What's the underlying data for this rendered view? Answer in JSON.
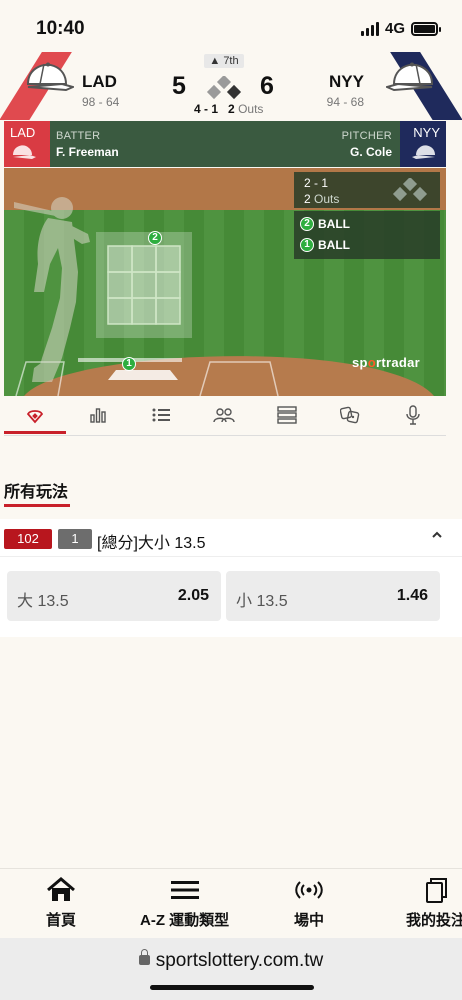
{
  "status_bar": {
    "time": "10:40",
    "network": "4G"
  },
  "scoreboard": {
    "home": {
      "abbr": "LAD",
      "record": "98 - 64",
      "score": "5",
      "color": "#e04a4f"
    },
    "away": {
      "abbr": "NYY",
      "record": "94 - 68",
      "score": "6",
      "color": "#1f2a5c"
    },
    "inning": "▲ 7th",
    "count": "4 - 1",
    "outs": "2",
    "outs_label": "Outs"
  },
  "matchup": {
    "batter_team": "LAD",
    "batter_label": "BATTER",
    "batter_name": "F. Freeman",
    "pitcher_team": "NYY",
    "pitcher_label": "PITCHER",
    "pitcher_name": "G. Cole"
  },
  "field": {
    "count": "2 - 1",
    "outs": "2",
    "outs_label": "Outs",
    "pitches": [
      {
        "number": "2",
        "result": "BALL"
      },
      {
        "number": "1",
        "result": "BALL"
      }
    ],
    "watermark": {
      "pre": "sp",
      "mid": "o",
      "post": "rtradar"
    }
  },
  "tabs": [
    {
      "icon": "baseball-field-icon",
      "active": true
    },
    {
      "icon": "stats-bars-icon",
      "active": false
    },
    {
      "icon": "play-by-play-list-icon",
      "active": false
    },
    {
      "icon": "lineup-players-icon",
      "active": false
    },
    {
      "icon": "standings-table-icon",
      "active": false
    },
    {
      "icon": "head-to-head-icon",
      "active": false
    },
    {
      "icon": "microphone-icon",
      "active": false
    }
  ],
  "section": {
    "title": "所有玩法"
  },
  "market": {
    "id_badge": "102",
    "count_badge": "1",
    "title": "[總分]大小 13.5",
    "options": [
      {
        "label": "大 13.5",
        "price": "2.05"
      },
      {
        "label": "小 13.5",
        "price": "1.46"
      }
    ]
  },
  "bottom_nav": [
    {
      "icon": "home-icon",
      "label": "首頁"
    },
    {
      "icon": "menu-icon",
      "label": "A-Z 運動類型"
    },
    {
      "icon": "live-broadcast-icon",
      "label": "場中"
    },
    {
      "icon": "my-bets-icon",
      "label": "我的投注"
    }
  ],
  "browser": {
    "url": "sportslottery.com.tw"
  },
  "colors": {
    "accent": "#c8202a",
    "field_green": "#4a8c3a",
    "panel": "#3a5a40",
    "ball_green": "#2eae3f"
  }
}
